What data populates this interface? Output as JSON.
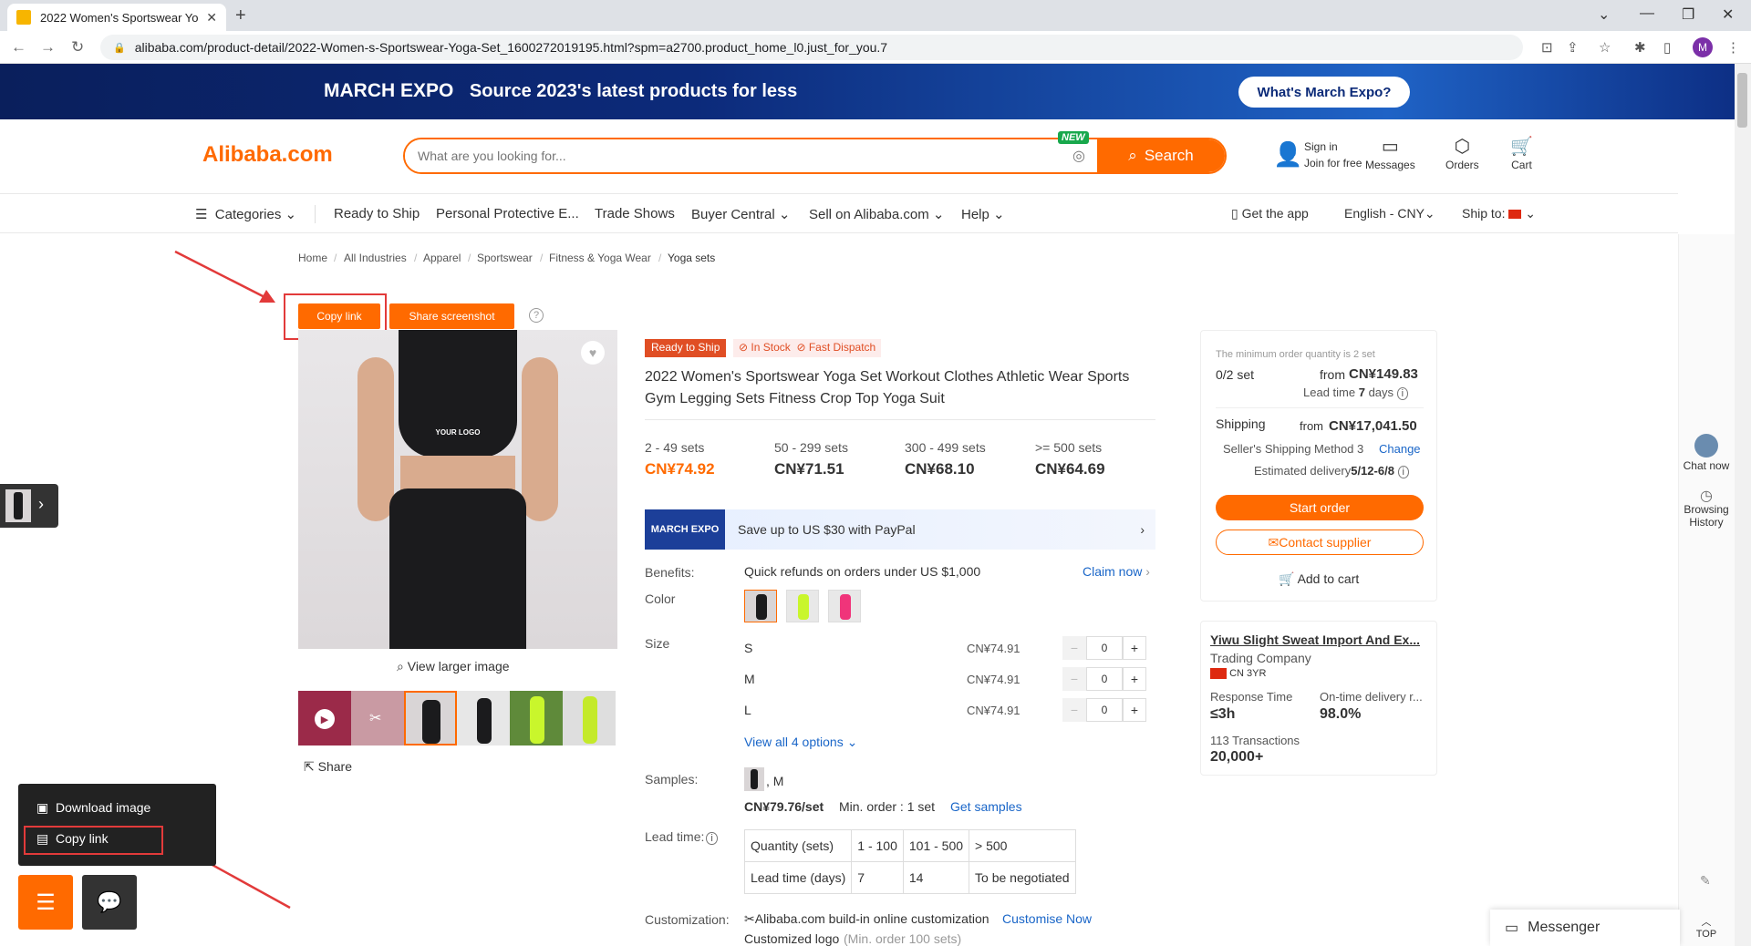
{
  "browser": {
    "tab_title": "2022 Women's Sportswear Yo",
    "url": "alibaba.com/product-detail/2022-Women-s-Sportswear-Yoga-Set_1600272019195.html?spm=a2700.product_home_l0.just_for_you.7",
    "profile_letter": "M"
  },
  "banner": {
    "expo": "MARCH EXPO",
    "text": "Source 2023's latest products for less",
    "button": "What's March Expo?"
  },
  "header": {
    "logo": "Alibaba.com",
    "search_placeholder": "What are you looking for...",
    "new_badge": "NEW",
    "search_button": "Search",
    "sign_in": "Sign in",
    "join": "Join for free",
    "messages": "Messages",
    "orders": "Orders",
    "cart": "Cart"
  },
  "nav": {
    "categories": "Categories",
    "ready": "Ready to Ship",
    "ppe": "Personal Protective E...",
    "trade_shows": "Trade Shows",
    "buyer_central": "Buyer Central",
    "sell": "Sell on Alibaba.com",
    "help": "Help",
    "get_app": "Get the app",
    "language": "English - CNY",
    "ship_to": "Ship to:"
  },
  "breadcrumb": [
    "Home",
    "All Industries",
    "Apparel",
    "Sportswear",
    "Fitness & Yoga Wear",
    "Yoga sets"
  ],
  "media": {
    "copy_link": "Copy link",
    "share_screenshot": "Share screenshot",
    "view_larger": "View larger image",
    "share": "Share",
    "logo_text": "YOUR LOGO"
  },
  "product": {
    "ready_badge": "Ready to Ship",
    "in_stock": "In Stock",
    "fast_dispatch": "Fast Dispatch",
    "title": "2022 Women's Sportswear Yoga Set Workout Clothes Athletic Wear Sports Gym Legging Sets Fitness Crop Top Yoga Suit",
    "tiers": [
      {
        "range": "2 - 49 sets",
        "price": "CN¥74.92"
      },
      {
        "range": "50 - 299 sets",
        "price": "CN¥71.51"
      },
      {
        "range": "300 - 499 sets",
        "price": "CN¥68.10"
      },
      {
        "range": ">= 500 sets",
        "price": "CN¥64.69"
      }
    ],
    "paypal_logo": "MARCH EXPO",
    "paypal_text": "Save up to US $30 with PayPal",
    "benefits_label": "Benefits:",
    "benefits_text": "Quick refunds on orders under US $1,000",
    "claim": "Claim now",
    "color_label": "Color",
    "size_label": "Size",
    "sizes": [
      {
        "name": "S",
        "price": "CN¥74.91",
        "qty": "0"
      },
      {
        "name": "M",
        "price": "CN¥74.91",
        "qty": "0"
      },
      {
        "name": "L",
        "price": "CN¥74.91",
        "qty": "0"
      }
    ],
    "view_all": "View all 4 options",
    "samples_label": "Samples:",
    "sample_variant": ", M",
    "sample_price": "CN¥79.76/set",
    "sample_min": "Min. order : 1 set",
    "get_samples": "Get samples",
    "lead_label": "Lead time:",
    "lead_rows": [
      [
        "Quantity (sets)",
        "1 - 100",
        "101 - 500",
        "> 500"
      ],
      [
        "Lead time (days)",
        "7",
        "14",
        "To be negotiated"
      ]
    ],
    "custom_label": "Customization:",
    "custom_text": "Alibaba.com build-in online customization",
    "customise_now": "Customise Now",
    "custom_logo": "Customized logo",
    "custom_logo_min": "(Min. order 100 sets)"
  },
  "order_card": {
    "min_note": "The minimum order quantity is 2 set",
    "qty": "0/2 set",
    "from": "from",
    "from_price": "CN¥149.83",
    "lead_time": "Lead time",
    "lead_days": "7",
    "lead_unit": "days",
    "shipping": "Shipping",
    "ship_price": "CN¥17,041.50",
    "method": "Seller's Shipping Method 3",
    "change": "Change",
    "est": "Estimated delivery",
    "est_date": "5/12-6/8",
    "start_order": "Start order",
    "contact": "Contact supplier",
    "add_cart": "Add to cart"
  },
  "supplier": {
    "name": "Yiwu Slight Sweat Import And Ex...",
    "type": "Trading Company",
    "country": "CN",
    "years": "3YR",
    "resp_label": "Response Time",
    "resp": "≤3h",
    "ontime_label": "On-time delivery r...",
    "ontime": "98.0%",
    "tx_label": "113 Transactions",
    "tx": "20,000+"
  },
  "rail": {
    "chat": "Chat now",
    "history_1": "Browsing",
    "history_2": "History",
    "top": "TOP"
  },
  "floating": {
    "download": "Download image",
    "copy": "Copy link",
    "messenger": "Messenger"
  }
}
